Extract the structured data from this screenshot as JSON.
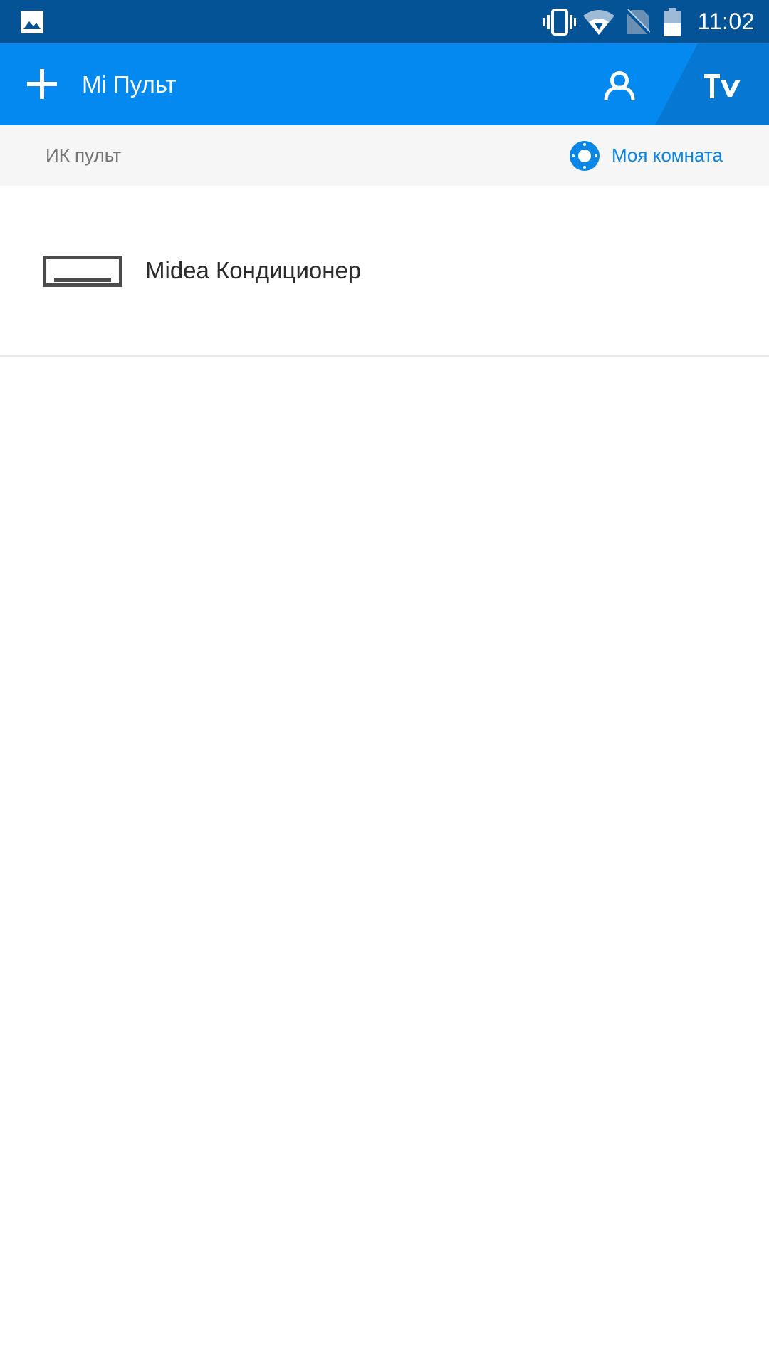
{
  "status_bar": {
    "time": "11:02",
    "icons": [
      "image-notification-icon",
      "vibrate-icon",
      "wifi-icon",
      "no-sim-icon",
      "battery-icon"
    ],
    "background": "#045397"
  },
  "app_bar": {
    "title": "Mi Пульт",
    "add_icon": "plus-icon",
    "profile_icon": "user-icon",
    "tv_label": "TV",
    "background": "#0389ef"
  },
  "sub_header": {
    "label": "ИК пульт",
    "room_label": "Моя комната",
    "room_icon": "room-dial-icon",
    "accent": "#0a86e6"
  },
  "devices": [
    {
      "name": "Midea Кондиционер",
      "icon": "air-conditioner-icon"
    }
  ]
}
